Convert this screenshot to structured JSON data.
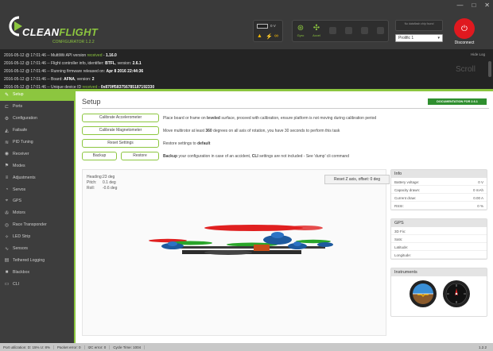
{
  "window": {
    "minimize": "—",
    "maximize": "□",
    "close": "✕"
  },
  "header": {
    "logo_word_a": "CLEAN",
    "logo_word_b": "FLIGHT",
    "logo_version": "CONFIGURATOR 1.2.2",
    "battery_voltage": "0 V",
    "sensors": [
      {
        "label": "Gyro",
        "state": "on",
        "icon": "gyro-icon"
      },
      {
        "label": "Accel",
        "state": "on",
        "icon": "accel-icon"
      },
      {
        "label": "",
        "state": "off",
        "icon": "mag-icon"
      },
      {
        "label": "",
        "state": "off",
        "icon": "baro-icon"
      },
      {
        "label": "",
        "state": "off",
        "icon": "gps-icon"
      },
      {
        "label": "",
        "state": "off",
        "icon": "sonar-icon"
      }
    ],
    "dataflash_label": "No dataflash chip found",
    "port": "Prolific 1",
    "disconnect_label": "Disconnect"
  },
  "log": {
    "hide_label": "Hide Log",
    "scroll_label": "Scroll",
    "lines": [
      {
        "prefix": "2016-05-12 @ 17:01:46 -- MultiWii API version ",
        "status": "received",
        "suffix": " - ",
        "bold": "1.16.0"
      },
      {
        "prefix": "2016-05-12 @ 17:01:46 -- Flight controller info, identifier: ",
        "status": "",
        "suffix": "",
        "bold": "BTFL",
        "tail": ", version: ",
        "bold2": "2.6.1"
      },
      {
        "prefix": "2016-05-12 @ 17:01:46 -- Running firmware released on: ",
        "status": "",
        "suffix": "",
        "bold": "Apr 8 2016 22:44:36"
      },
      {
        "prefix": "2016-05-12 @ 17:01:46 -- Board: ",
        "status": "",
        "suffix": "",
        "bold": "AFNA",
        "tail": ", version: ",
        "bold2": "2"
      },
      {
        "prefix": "2016-05-12 @ 17:01:46 -- Unique device ID ",
        "status": "received",
        "suffix": " - ",
        "bold": "0x870ff583756785187192330"
      }
    ]
  },
  "sidebar": {
    "items": [
      {
        "label": "Setup",
        "icon": "wrench-icon",
        "active": true
      },
      {
        "label": "Ports",
        "icon": "ports-icon"
      },
      {
        "label": "Configuration",
        "icon": "gear-icon"
      },
      {
        "label": "Failsafe",
        "icon": "failsafe-icon"
      },
      {
        "label": "PID Tuning",
        "icon": "pid-icon"
      },
      {
        "label": "Receiver",
        "icon": "receiver-icon"
      },
      {
        "label": "Modes",
        "icon": "modes-icon"
      },
      {
        "label": "Adjustments",
        "icon": "adjustments-icon"
      },
      {
        "label": "Servos",
        "icon": "servo-icon"
      },
      {
        "label": "GPS",
        "icon": "gps-icon"
      },
      {
        "label": "Motors",
        "icon": "motor-icon"
      },
      {
        "label": "Race Transponder",
        "icon": "transponder-icon"
      },
      {
        "label": "LED Strip",
        "icon": "led-icon"
      },
      {
        "label": "Sensors",
        "icon": "sensors-icon"
      },
      {
        "label": "Tethered Logging",
        "icon": "logging-icon"
      },
      {
        "label": "Blackbox",
        "icon": "blackbox-icon"
      },
      {
        "label": "CLI",
        "icon": "cli-icon"
      }
    ]
  },
  "main": {
    "title": "Setup",
    "doc_button": "DOCUMENTATION FOR 2.6.1",
    "actions": {
      "calibrate_acc": "Calibrate Accelerometer",
      "calibrate_acc_desc_a": "Place board or frame on ",
      "calibrate_acc_desc_b": "leveled",
      "calibrate_acc_desc_c": " surface, proceed with calibration, ensure platform is not moving during calibration period",
      "calibrate_mag": "Calibrate Magnetometer",
      "calibrate_mag_desc_a": "Move multirotor at least ",
      "calibrate_mag_desc_b": "360",
      "calibrate_mag_desc_c": " degrees on all axis of rotation, you have 30 seconds to perform this task",
      "reset_settings": "Reset Settings",
      "reset_desc_a": "Restore settings to ",
      "reset_desc_b": "default",
      "backup": "Backup",
      "restore": "Restore",
      "backup_desc_a": "Backup",
      "backup_desc_b": " your configuration in case of an accident, ",
      "backup_desc_c": "CLI",
      "backup_desc_d": " settings are not included - See 'dump' cli command"
    },
    "attitude": {
      "heading_label": "Heading:",
      "heading": "23 deg",
      "pitch_label": "Pitch:",
      "pitch": "0.1 deg",
      "roll_label": "Roll:",
      "roll": "-0.6 deg"
    },
    "reset_z": "Reset Z axis, offset: 0 deg",
    "info": {
      "title": "Info",
      "rows": [
        {
          "label": "Battery voltage:",
          "value": "0 V"
        },
        {
          "label": "Capacity drawn:",
          "value": "0 mAh"
        },
        {
          "label": "Current draw:",
          "value": "0.00 A"
        },
        {
          "label": "RSSI:",
          "value": "0 %"
        }
      ]
    },
    "gps": {
      "title": "GPS",
      "rows": [
        {
          "label": "3D Fix:",
          "value": ""
        },
        {
          "label": "Sats:",
          "value": ""
        },
        {
          "label": "Latitude:",
          "value": ""
        },
        {
          "label": "Longitude:",
          "value": ""
        }
      ]
    },
    "instruments": {
      "title": "Instruments"
    }
  },
  "status_bar": {
    "port_util": "Port utilization: D: 15% U: 8%",
    "packet_error": "Packet error: 0",
    "i2c_error": "I2C error: 0",
    "cycle_time": "Cycle Time: 1004",
    "version": "1.2.2"
  },
  "colors": {
    "accent": "#8cc63f",
    "header": "#3a3a3a",
    "log_bg": "#242424",
    "sidebar": "#3d3d3d",
    "disconnect": "#e0191f"
  }
}
